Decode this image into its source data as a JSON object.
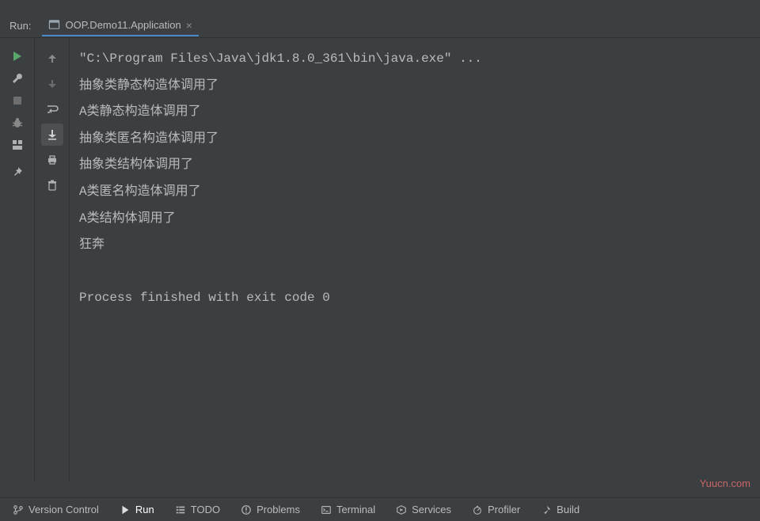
{
  "header": {
    "run_label": "Run:",
    "tab_title": "OOP.Demo11.Application"
  },
  "console": {
    "command": "\"C:\\Program Files\\Java\\jdk1.8.0_361\\bin\\java.exe\" ...",
    "lines": [
      "抽象类静态构造体调用了",
      "A类静态构造体调用了",
      "抽象类匿名构造体调用了",
      "抽象类结构体调用了",
      "A类匿名构造体调用了",
      "A类结构体调用了",
      "狂奔"
    ],
    "exit_line": "Process finished with exit code 0"
  },
  "footer": {
    "version_control": "Version Control",
    "run": "Run",
    "todo": "TODO",
    "problems": "Problems",
    "terminal": "Terminal",
    "services": "Services",
    "profiler": "Profiler",
    "build": "Build"
  },
  "watermark": "Yuucn.com"
}
